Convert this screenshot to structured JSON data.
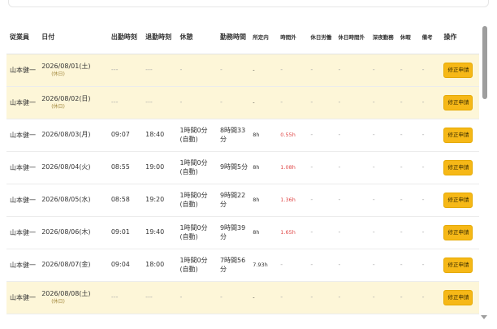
{
  "headers": {
    "employee": "従業員",
    "date": "日付",
    "clock_in": "出勤時刻",
    "clock_out": "退勤時刻",
    "break": "休憩",
    "work_time": "勤務時間",
    "scheduled": "所定内",
    "overtime": "時間外",
    "holiday_work": "休日労働",
    "holiday_overtime": "休日時間外",
    "late_night": "深夜勤務",
    "absence": "休暇",
    "remarks": "備考",
    "action": "操作"
  },
  "rows": [
    {
      "employee": "山本健一",
      "date": "2026/08/01(土)",
      "holiday": "(休日)",
      "clock_in": "---",
      "clock_out": "---",
      "break": "-",
      "work_time": "-",
      "scheduled": "-",
      "overtime": "-",
      "holiday_work": "-",
      "holiday_overtime": "-",
      "late_night": "-",
      "absence": "-",
      "remarks": "-",
      "action": "修正申請",
      "weekend": true
    },
    {
      "employee": "山本健一",
      "date": "2026/08/02(日)",
      "holiday": "(休日)",
      "clock_in": "---",
      "clock_out": "---",
      "break": "-",
      "work_time": "-",
      "scheduled": "-",
      "overtime": "-",
      "holiday_work": "-",
      "holiday_overtime": "-",
      "late_night": "-",
      "absence": "-",
      "remarks": "-",
      "action": "修正申請",
      "weekend": true
    },
    {
      "employee": "山本健一",
      "date": "2026/08/03(月)",
      "holiday": "",
      "clock_in": "09:07",
      "clock_out": "18:40",
      "break": "1時間0分 (自動)",
      "work_time": "8時間33分",
      "scheduled": "8h",
      "overtime": "0.55h",
      "holiday_work": "-",
      "holiday_overtime": "-",
      "late_night": "-",
      "absence": "-",
      "remarks": "-",
      "action": "修正申請",
      "weekend": false
    },
    {
      "employee": "山本健一",
      "date": "2026/08/04(火)",
      "holiday": "",
      "clock_in": "08:55",
      "clock_out": "19:00",
      "break": "1時間0分 (自動)",
      "work_time": "9時間5分",
      "scheduled": "8h",
      "overtime": "1.08h",
      "holiday_work": "-",
      "holiday_overtime": "-",
      "late_night": "-",
      "absence": "-",
      "remarks": "-",
      "action": "修正申請",
      "weekend": false
    },
    {
      "employee": "山本健一",
      "date": "2026/08/05(水)",
      "holiday": "",
      "clock_in": "08:58",
      "clock_out": "19:20",
      "break": "1時間0分 (自動)",
      "work_time": "9時間22分",
      "scheduled": "8h",
      "overtime": "1.36h",
      "holiday_work": "-",
      "holiday_overtime": "-",
      "late_night": "-",
      "absence": "-",
      "remarks": "-",
      "action": "修正申請",
      "weekend": false
    },
    {
      "employee": "山本健一",
      "date": "2026/08/06(木)",
      "holiday": "",
      "clock_in": "09:01",
      "clock_out": "19:40",
      "break": "1時間0分 (自動)",
      "work_time": "9時間39分",
      "scheduled": "8h",
      "overtime": "1.65h",
      "holiday_work": "-",
      "holiday_overtime": "-",
      "late_night": "-",
      "absence": "-",
      "remarks": "-",
      "action": "修正申請",
      "weekend": false
    },
    {
      "employee": "山本健一",
      "date": "2026/08/07(金)",
      "holiday": "",
      "clock_in": "09:04",
      "clock_out": "18:00",
      "break": "1時間0分 (自動)",
      "work_time": "7時間56分",
      "scheduled": "7.93h",
      "overtime": "-",
      "holiday_work": "-",
      "holiday_overtime": "-",
      "late_night": "-",
      "absence": "-",
      "remarks": "-",
      "action": "修正申請",
      "weekend": false
    },
    {
      "employee": "山本健一",
      "date": "2026/08/08(土)",
      "holiday": "(休日)",
      "clock_in": "---",
      "clock_out": "---",
      "break": "-",
      "work_time": "-",
      "scheduled": "-",
      "overtime": "-",
      "holiday_work": "-",
      "holiday_overtime": "-",
      "late_night": "-",
      "absence": "-",
      "remarks": "-",
      "action": "修正申請",
      "weekend": true
    }
  ],
  "colors": {
    "weekend_row": "#fdf6d8",
    "button": "#f6b817",
    "overtime_text": "#e04848"
  }
}
